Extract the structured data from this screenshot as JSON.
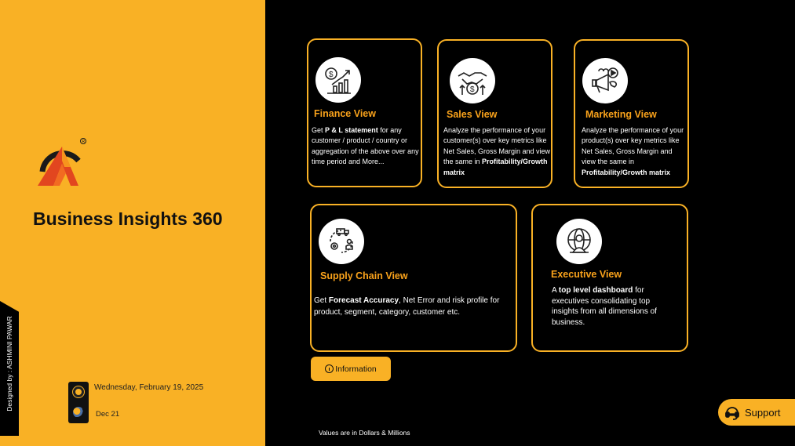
{
  "app": {
    "title": "Business Insights 360",
    "designer": "Designed by : ASHMINI PAWAR",
    "refresh_date": "Wednesday, February 19, 2025",
    "data_period": "Dec 21",
    "footer_note": "Values are in Dollars & Millions"
  },
  "cards": {
    "finance": {
      "title": "Finance View",
      "icon": "finance-chart-icon",
      "desc_parts": [
        "Get ",
        "P & L statement",
        " for any customer / product / country or aggregation of the above over any time period and More..."
      ]
    },
    "sales": {
      "title": "Sales View",
      "icon": "handshake-dollar-icon",
      "desc_parts": [
        "Analyze the performance of your customer(s) over key metrics like Net Sales, Gross Margin and view the same in ",
        "Profitability/Growth matrix"
      ]
    },
    "marketing": {
      "title": "Marketing View",
      "icon": "megaphone-icon",
      "desc_parts": [
        "Analyze the performance of your product(s) over key metrics like Net Sales, Gross Margin and view the same in ",
        "Profitability/Growth matrix"
      ]
    },
    "supply": {
      "title": "Supply Chain View",
      "icon": "supply-chain-icon",
      "desc_parts": [
        "Get ",
        "Forecast Accuracy",
        ", Net Error and risk profile for product, segment, category, customer etc."
      ]
    },
    "executive": {
      "title": "Executive View",
      "icon": "executive-globe-icon",
      "desc_parts": [
        "A ",
        "top level dashboard",
        " for executives consolidating top insights from all dimensions of business."
      ]
    }
  },
  "buttons": {
    "information": "Information",
    "support": "Support"
  },
  "colors": {
    "accent": "#F9B125",
    "title_orange": "#F9A21B",
    "background": "#000000"
  }
}
